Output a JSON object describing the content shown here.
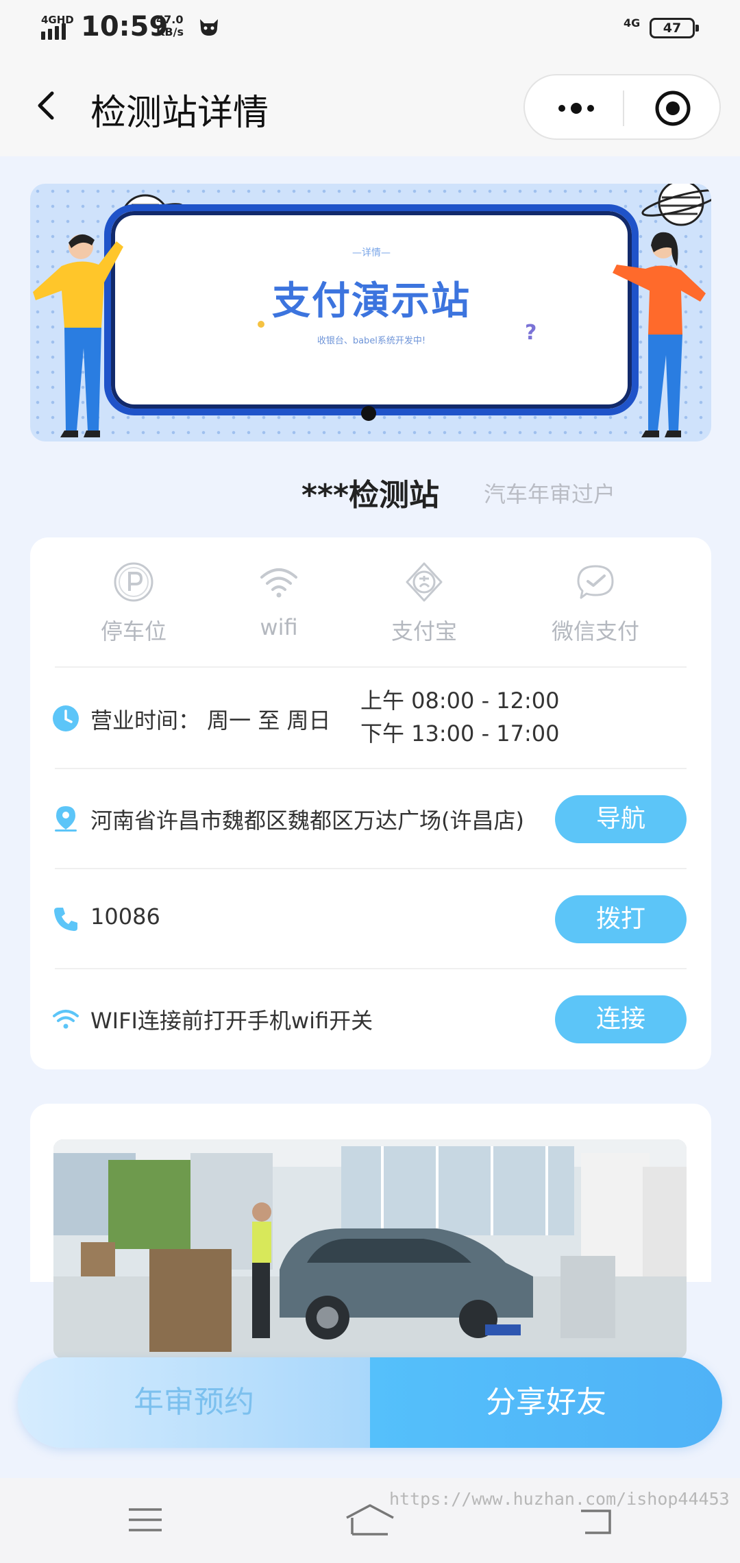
{
  "status_bar": {
    "network_tag": "4GHD",
    "time": "10:59",
    "speed_value": "47.0",
    "speed_unit": "KB/s",
    "network_right": "4G",
    "battery": "47"
  },
  "header": {
    "title": "检测站详情",
    "back_icon": "chevron-left-icon",
    "more_icon": "more-dots-icon",
    "close_icon": "target-circle-icon"
  },
  "banner": {
    "subtitle": "—详情—",
    "heading": "支付演示站",
    "note": "收银台、babel系统开发中!",
    "colors": {
      "frame": "#1f53c9",
      "heading": "#3c74de"
    }
  },
  "station": {
    "name": "***检测站",
    "tag": "汽车年审过户"
  },
  "amenities": [
    {
      "icon": "parking-icon",
      "label": "停车位"
    },
    {
      "icon": "wifi-icon",
      "label": "wifi"
    },
    {
      "icon": "alipay-icon",
      "label": "支付宝"
    },
    {
      "icon": "wechat-pay-icon",
      "label": "微信支付"
    }
  ],
  "info": {
    "hours_label": "营业时间：  周一 至 周日",
    "hours_am": "上午 08:00 - 12:00",
    "hours_pm": "下午 13:00 - 17:00",
    "address": "河南省许昌市魏都区魏都区万达广场(许昌店)",
    "navigate_label": "导航",
    "phone": "10086",
    "call_label": "拨打",
    "wifi_text": "WIFI连接前打开手机wifi开关",
    "connect_label": "连接"
  },
  "actions": {
    "left_label": "年审预约",
    "right_label": "分享好友"
  },
  "navbar": {
    "icons": [
      "menu-icon",
      "home-icon",
      "back-icon"
    ]
  },
  "watermark": "https://www.huzhan.com/ishop44453",
  "colors": {
    "accent": "#5cc5f8",
    "page_bg": "#eef3fd",
    "card_bg": "#ffffff",
    "muted_text": "#b4b8bf"
  }
}
